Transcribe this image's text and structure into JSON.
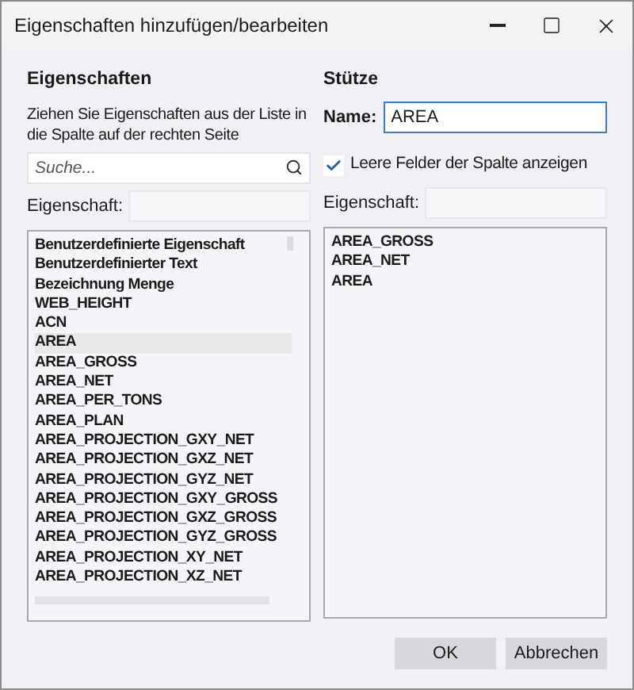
{
  "window": {
    "title": "Eigenschaften hinzufügen/bearbeiten"
  },
  "left": {
    "heading": "Eigenschaften",
    "hint": "Ziehen Sie Eigenschaften aus der Liste in die Spalte auf der rechten Seite",
    "search": {
      "placeholder": "Suche..."
    },
    "property_label": "Eigenschaft:",
    "items": [
      {
        "label": "Benutzerdefinierte Eigenschaft",
        "selected": false
      },
      {
        "label": "Benutzerdefinierter Text",
        "selected": false
      },
      {
        "label": "Bezeichnung Menge",
        "selected": false
      },
      {
        "label": "WEB_HEIGHT",
        "selected": false
      },
      {
        "label": "ACN",
        "selected": false
      },
      {
        "label": "AREA",
        "selected": true
      },
      {
        "label": "AREA_GROSS",
        "selected": false
      },
      {
        "label": "AREA_NET",
        "selected": false
      },
      {
        "label": "AREA_PER_TONS",
        "selected": false
      },
      {
        "label": "AREA_PLAN",
        "selected": false
      },
      {
        "label": "AREA_PROJECTION_GXY_NET",
        "selected": false
      },
      {
        "label": "AREA_PROJECTION_GXZ_NET",
        "selected": false
      },
      {
        "label": "AREA_PROJECTION_GYZ_NET",
        "selected": false
      },
      {
        "label": "AREA_PROJECTION_GXY_GROSS",
        "selected": false
      },
      {
        "label": "AREA_PROJECTION_GXZ_GROSS",
        "selected": false
      },
      {
        "label": "AREA_PROJECTION_GYZ_GROSS",
        "selected": false
      },
      {
        "label": "AREA_PROJECTION_XY_NET",
        "selected": false
      },
      {
        "label": "AREA_PROJECTION_XZ_NET",
        "selected": false
      }
    ]
  },
  "right": {
    "heading": "Stütze",
    "name_label": "Name:",
    "name_value": "AREA",
    "show_empty": {
      "label": "Leere Felder der Spalte anzeigen",
      "checked": true
    },
    "property_label": "Eigenschaft:",
    "items": [
      "AREA_GROSS",
      "AREA_NET",
      "AREA"
    ]
  },
  "buttons": [
    {
      "label": "OK"
    },
    {
      "label": "Abbrechen"
    }
  ]
}
